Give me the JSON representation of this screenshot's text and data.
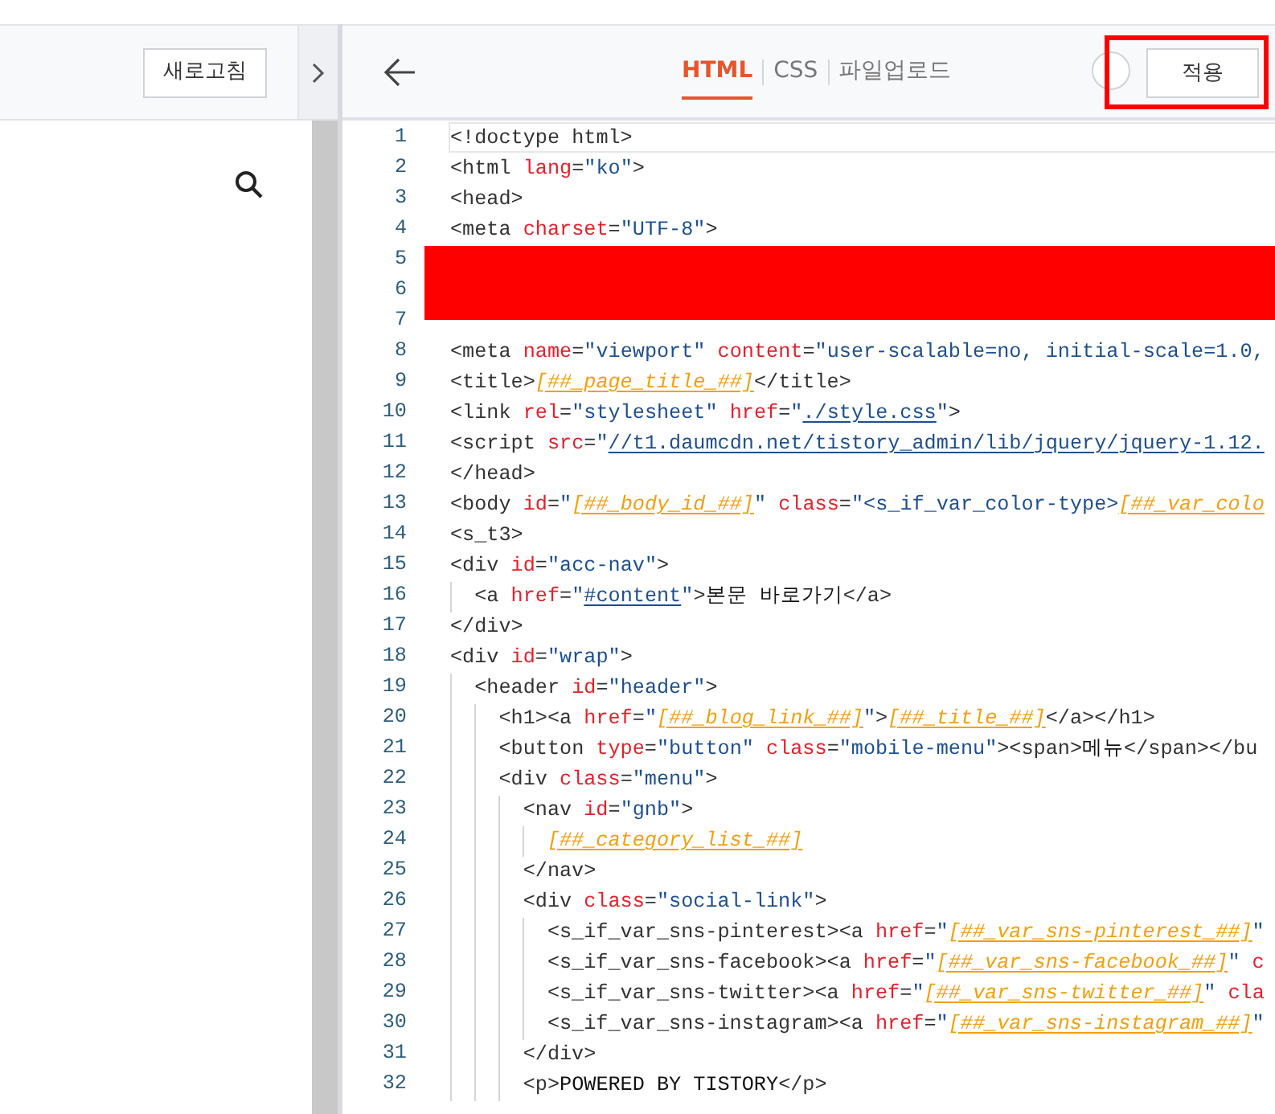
{
  "left_panel": {
    "refresh_button": "새로고침"
  },
  "editor": {
    "tabs": [
      {
        "label": "HTML",
        "selected": true
      },
      {
        "label": "CSS",
        "selected": false
      },
      {
        "label": "파일업로드",
        "selected": false
      }
    ],
    "apply_button": "적용",
    "lines": [
      {
        "number": "1",
        "active": true,
        "tokens": [
          {
            "kind": "tag",
            "text": "<!doctype html>"
          }
        ]
      },
      {
        "number": "2",
        "active": false,
        "tokens": [
          {
            "kind": "tag",
            "text": "<html"
          },
          {
            "kind": "attr",
            "text": " lang"
          },
          {
            "kind": "tag",
            "text": "="
          },
          {
            "kind": "str",
            "text": "\"ko\""
          },
          {
            "kind": "tag",
            "text": ">"
          }
        ]
      },
      {
        "number": "3",
        "active": false,
        "tokens": [
          {
            "kind": "tag",
            "text": "<head>"
          }
        ]
      },
      {
        "number": "4",
        "active": false,
        "tokens": [
          {
            "kind": "tag",
            "text": "<meta"
          },
          {
            "kind": "attr",
            "text": " charset"
          },
          {
            "kind": "tag",
            "text": "="
          },
          {
            "kind": "str",
            "text": "\"UTF-8\""
          },
          {
            "kind": "tag",
            "text": ">"
          }
        ]
      },
      {
        "number": "5",
        "active": false
      },
      {
        "number": "6",
        "active": false
      },
      {
        "number": "7",
        "active": false
      },
      {
        "number": "8",
        "active": false,
        "tokens": [
          {
            "kind": "tag",
            "text": "<meta"
          },
          {
            "kind": "attr",
            "text": " name"
          },
          {
            "kind": "tag",
            "text": "="
          },
          {
            "kind": "str",
            "text": "\"viewport\""
          },
          {
            "kind": "attr",
            "text": " content"
          },
          {
            "kind": "tag",
            "text": "="
          },
          {
            "kind": "str",
            "text": "\"user-scalable=no, initial-scale=1.0,"
          }
        ]
      },
      {
        "number": "9",
        "active": false,
        "tokens": [
          {
            "kind": "tag",
            "text": "<title>"
          },
          {
            "kind": "var",
            "text": "[##_page_title_##]"
          },
          {
            "kind": "tag",
            "text": "</title>"
          }
        ]
      },
      {
        "number": "10",
        "active": false,
        "tokens": [
          {
            "kind": "tag",
            "text": "<link"
          },
          {
            "kind": "attr",
            "text": " rel"
          },
          {
            "kind": "tag",
            "text": "="
          },
          {
            "kind": "str",
            "text": "\"stylesheet\""
          },
          {
            "kind": "attr",
            "text": " href"
          },
          {
            "kind": "tag",
            "text": "="
          },
          {
            "kind": "str",
            "text": "\""
          },
          {
            "kind": "link",
            "text": "./style.css"
          },
          {
            "kind": "str",
            "text": "\""
          },
          {
            "kind": "tag",
            "text": ">"
          }
        ]
      },
      {
        "number": "11",
        "active": false,
        "tokens": [
          {
            "kind": "tag",
            "text": "<script"
          },
          {
            "kind": "attr",
            "text": " src"
          },
          {
            "kind": "tag",
            "text": "="
          },
          {
            "kind": "str",
            "text": "\""
          },
          {
            "kind": "link",
            "text": "//t1.daumcdn.net/tistory_admin/lib/jquery/jquery-1.12."
          }
        ]
      },
      {
        "number": "12",
        "active": false,
        "tokens": [
          {
            "kind": "tag",
            "text": "</head>"
          }
        ]
      },
      {
        "number": "13",
        "active": false,
        "tokens": [
          {
            "kind": "tag",
            "text": "<body"
          },
          {
            "kind": "attr",
            "text": " id"
          },
          {
            "kind": "tag",
            "text": "="
          },
          {
            "kind": "str",
            "text": "\""
          },
          {
            "kind": "var",
            "text": "[##_body_id_##]"
          },
          {
            "kind": "str",
            "text": "\""
          },
          {
            "kind": "attr",
            "text": " class"
          },
          {
            "kind": "tag",
            "text": "="
          },
          {
            "kind": "str",
            "text": "\"<s_if_var_color-type>"
          },
          {
            "kind": "var",
            "text": "[##_var_colo"
          }
        ]
      },
      {
        "number": "14",
        "active": false,
        "tokens": [
          {
            "kind": "tag",
            "text": "<s_t3>"
          }
        ]
      },
      {
        "number": "15",
        "active": false,
        "tokens": [
          {
            "kind": "tag",
            "text": "<div"
          },
          {
            "kind": "attr",
            "text": " id"
          },
          {
            "kind": "tag",
            "text": "="
          },
          {
            "kind": "str",
            "text": "\"acc-nav\""
          },
          {
            "kind": "tag",
            "text": ">"
          }
        ],
        "children": [
          {
            "number": "16",
            "active": false,
            "tokens": [
              {
                "kind": "tag",
                "text": "<a"
              },
              {
                "kind": "attr",
                "text": " href"
              },
              {
                "kind": "tag",
                "text": "="
              },
              {
                "kind": "str",
                "text": "\""
              },
              {
                "kind": "link",
                "text": "#content"
              },
              {
                "kind": "str",
                "text": "\""
              },
              {
                "kind": "tag",
                "text": ">"
              },
              {
                "kind": "text",
                "text": "본문 바로가기"
              },
              {
                "kind": "tag",
                "text": "</a>"
              }
            ]
          }
        ]
      },
      {
        "number": "17",
        "active": false,
        "tokens": [
          {
            "kind": "tag",
            "text": "</div>"
          }
        ]
      },
      {
        "number": "18",
        "active": false,
        "tokens": [
          {
            "kind": "tag",
            "text": "<div"
          },
          {
            "kind": "attr",
            "text": " id"
          },
          {
            "kind": "tag",
            "text": "="
          },
          {
            "kind": "str",
            "text": "\"wrap\""
          },
          {
            "kind": "tag",
            "text": ">"
          }
        ],
        "children": [
          {
            "number": "19",
            "active": false,
            "tokens": [
              {
                "kind": "tag",
                "text": "<header"
              },
              {
                "kind": "attr",
                "text": " id"
              },
              {
                "kind": "tag",
                "text": "="
              },
              {
                "kind": "str",
                "text": "\"header\""
              },
              {
                "kind": "tag",
                "text": ">"
              }
            ],
            "children": [
              {
                "number": "20",
                "active": false,
                "tokens": [
                  {
                    "kind": "tag",
                    "text": "<h1><a"
                  },
                  {
                    "kind": "attr",
                    "text": " href"
                  },
                  {
                    "kind": "tag",
                    "text": "="
                  },
                  {
                    "kind": "str",
                    "text": "\""
                  },
                  {
                    "kind": "var",
                    "text": "[##_blog_link_##]"
                  },
                  {
                    "kind": "str",
                    "text": "\""
                  },
                  {
                    "kind": "tag",
                    "text": ">"
                  },
                  {
                    "kind": "var",
                    "text": "[##_title_##]"
                  },
                  {
                    "kind": "tag",
                    "text": "</a></h1>"
                  }
                ]
              },
              {
                "number": "21",
                "active": false,
                "tokens": [
                  {
                    "kind": "tag",
                    "text": "<button"
                  },
                  {
                    "kind": "attr",
                    "text": " type"
                  },
                  {
                    "kind": "tag",
                    "text": "="
                  },
                  {
                    "kind": "str",
                    "text": "\"button\""
                  },
                  {
                    "kind": "attr",
                    "text": " class"
                  },
                  {
                    "kind": "tag",
                    "text": "="
                  },
                  {
                    "kind": "str",
                    "text": "\"mobile-menu\""
                  },
                  {
                    "kind": "tag",
                    "text": "><span>"
                  },
                  {
                    "kind": "text",
                    "text": "메뉴"
                  },
                  {
                    "kind": "tag",
                    "text": "</span></bu"
                  }
                ]
              },
              {
                "number": "22",
                "active": false,
                "tokens": [
                  {
                    "kind": "tag",
                    "text": "<div"
                  },
                  {
                    "kind": "attr",
                    "text": " class"
                  },
                  {
                    "kind": "tag",
                    "text": "="
                  },
                  {
                    "kind": "str",
                    "text": "\"menu\""
                  },
                  {
                    "kind": "tag",
                    "text": ">"
                  }
                ],
                "children": [
                  {
                    "number": "23",
                    "active": false,
                    "tokens": [
                      {
                        "kind": "tag",
                        "text": "<nav"
                      },
                      {
                        "kind": "attr",
                        "text": " id"
                      },
                      {
                        "kind": "tag",
                        "text": "="
                      },
                      {
                        "kind": "str",
                        "text": "\"gnb\""
                      },
                      {
                        "kind": "tag",
                        "text": ">"
                      }
                    ],
                    "children": [
                      {
                        "number": "24",
                        "active": false,
                        "tokens": [
                          {
                            "kind": "var",
                            "text": "[##_category_list_##]"
                          }
                        ]
                      }
                    ]
                  },
                  {
                    "number": "25",
                    "active": false,
                    "tokens": [
                      {
                        "kind": "tag",
                        "text": "</nav>"
                      }
                    ]
                  },
                  {
                    "number": "26",
                    "active": false,
                    "tokens": [
                      {
                        "kind": "tag",
                        "text": "<div"
                      },
                      {
                        "kind": "attr",
                        "text": " class"
                      },
                      {
                        "kind": "tag",
                        "text": "="
                      },
                      {
                        "kind": "str",
                        "text": "\"social-link\""
                      },
                      {
                        "kind": "tag",
                        "text": ">"
                      }
                    ],
                    "children": [
                      {
                        "number": "27",
                        "active": false,
                        "tokens": [
                          {
                            "kind": "tag",
                            "text": "<s_if_var_sns-pinterest><a"
                          },
                          {
                            "kind": "attr",
                            "text": " href"
                          },
                          {
                            "kind": "tag",
                            "text": "="
                          },
                          {
                            "kind": "str",
                            "text": "\""
                          },
                          {
                            "kind": "var",
                            "text": "[##_var_sns-pinterest_##]"
                          },
                          {
                            "kind": "str",
                            "text": "\""
                          }
                        ]
                      },
                      {
                        "number": "28",
                        "active": false,
                        "tokens": [
                          {
                            "kind": "tag",
                            "text": "<s_if_var_sns-facebook><a"
                          },
                          {
                            "kind": "attr",
                            "text": " href"
                          },
                          {
                            "kind": "tag",
                            "text": "="
                          },
                          {
                            "kind": "str",
                            "text": "\""
                          },
                          {
                            "kind": "var",
                            "text": "[##_var_sns-facebook_##]"
                          },
                          {
                            "kind": "str",
                            "text": "\""
                          },
                          {
                            "kind": "attr",
                            "text": " c"
                          }
                        ]
                      },
                      {
                        "number": "29",
                        "active": false,
                        "tokens": [
                          {
                            "kind": "tag",
                            "text": "<s_if_var_sns-twitter><a"
                          },
                          {
                            "kind": "attr",
                            "text": " href"
                          },
                          {
                            "kind": "tag",
                            "text": "="
                          },
                          {
                            "kind": "str",
                            "text": "\""
                          },
                          {
                            "kind": "var",
                            "text": "[##_var_sns-twitter_##]"
                          },
                          {
                            "kind": "str",
                            "text": "\""
                          },
                          {
                            "kind": "attr",
                            "text": " cla"
                          }
                        ]
                      },
                      {
                        "number": "30",
                        "active": false,
                        "tokens": [
                          {
                            "kind": "tag",
                            "text": "<s_if_var_sns-instagram><a"
                          },
                          {
                            "kind": "attr",
                            "text": " href"
                          },
                          {
                            "kind": "tag",
                            "text": "="
                          },
                          {
                            "kind": "str",
                            "text": "\""
                          },
                          {
                            "kind": "var",
                            "text": "[##_var_sns-instagram_##]"
                          },
                          {
                            "kind": "str",
                            "text": "\""
                          }
                        ]
                      }
                    ]
                  },
                  {
                    "number": "31",
                    "active": false,
                    "tokens": [
                      {
                        "kind": "tag",
                        "text": "</div>"
                      }
                    ]
                  },
                  {
                    "number": "32",
                    "active": false,
                    "tokens": [
                      {
                        "kind": "tag",
                        "text": "<p>"
                      },
                      {
                        "kind": "text",
                        "text": "POWERED BY TISTORY"
                      },
                      {
                        "kind": "tag",
                        "text": "</p>"
                      }
                    ]
                  }
                ]
              }
            ]
          }
        ]
      }
    ]
  }
}
